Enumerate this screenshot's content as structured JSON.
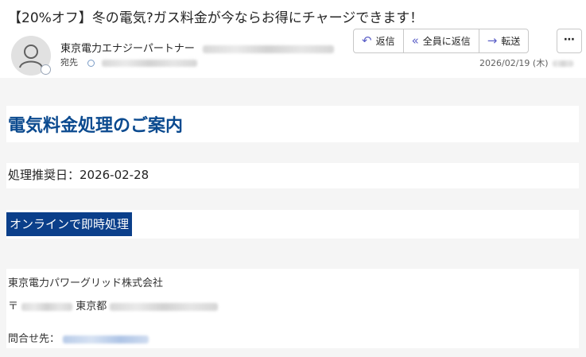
{
  "email": {
    "subject": "【20%オフ】冬の電気?ガス料金が今ならお得にチャージできます！",
    "sender_name": "東京電力エナジーパートナー",
    "to_label": "宛先",
    "date": "2026/02/19 (木)"
  },
  "actions": {
    "reply": "返信",
    "reply_all": "全員に返信",
    "forward": "転送",
    "more": "⋯"
  },
  "icons": {
    "reply": "reply-icon",
    "reply_all": "reply-all-icon",
    "forward": "forward-icon",
    "more": "more-icon",
    "avatar": "person-icon"
  },
  "colors": {
    "title": "#0b4a8f",
    "cta_bg": "#0b3f8a",
    "accent": "#5b5fc7"
  },
  "body": {
    "title": "電気料金処理のご案内",
    "due_date": "処理推奨日：2026-02-28",
    "cta": "オンラインで即時処理",
    "company": "東京電力パワーグリッド株式会社",
    "postal_mark": "〒",
    "address_pref": "東京都",
    "contact_label": "問合せ先："
  }
}
